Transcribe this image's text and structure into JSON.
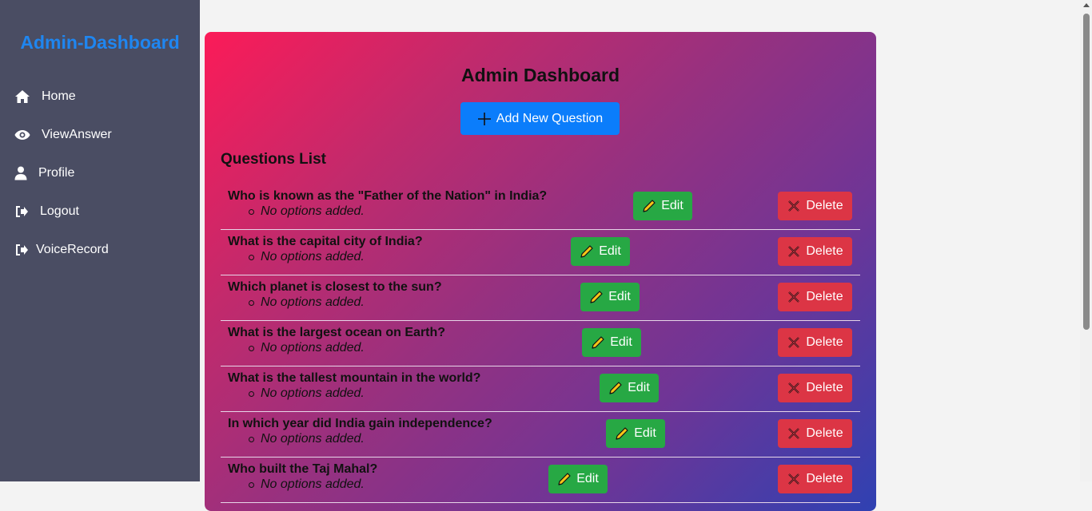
{
  "sidebar": {
    "brand": "Admin-Dashboard",
    "items": [
      {
        "label": "Home",
        "icon": "home-icon"
      },
      {
        "label": "ViewAnswer",
        "icon": "eye-icon"
      },
      {
        "label": "Profile",
        "icon": "user-icon"
      },
      {
        "label": "Logout",
        "icon": "logout-icon"
      },
      {
        "label": "VoiceRecord",
        "icon": "logout-icon"
      }
    ]
  },
  "main": {
    "title": "Admin Dashboard",
    "add_button": "Add New Question",
    "list_title": "Questions List",
    "edit_label": "Edit",
    "delete_label": "Delete",
    "questions": [
      {
        "text": "Who is known as the \"Father of the Nation\" in India?",
        "option": "No options added."
      },
      {
        "text": "What is the capital city of India?",
        "option": "No options added."
      },
      {
        "text": "Which planet is closest to the sun?",
        "option": "No options added."
      },
      {
        "text": "What is the largest ocean on Earth?",
        "option": "No options added."
      },
      {
        "text": "What is the tallest mountain in the world?",
        "option": "No options added."
      },
      {
        "text": "In which year did India gain independence?",
        "option": "No options added."
      },
      {
        "text": "Who built the Taj Mahal?",
        "option": "No options added."
      }
    ]
  },
  "colors": {
    "brand": "#1f86f0",
    "sidebar": "#4a4d63",
    "add_button": "#0b7dfb",
    "edit_button": "#27a844",
    "delete_button": "#dc3545"
  }
}
